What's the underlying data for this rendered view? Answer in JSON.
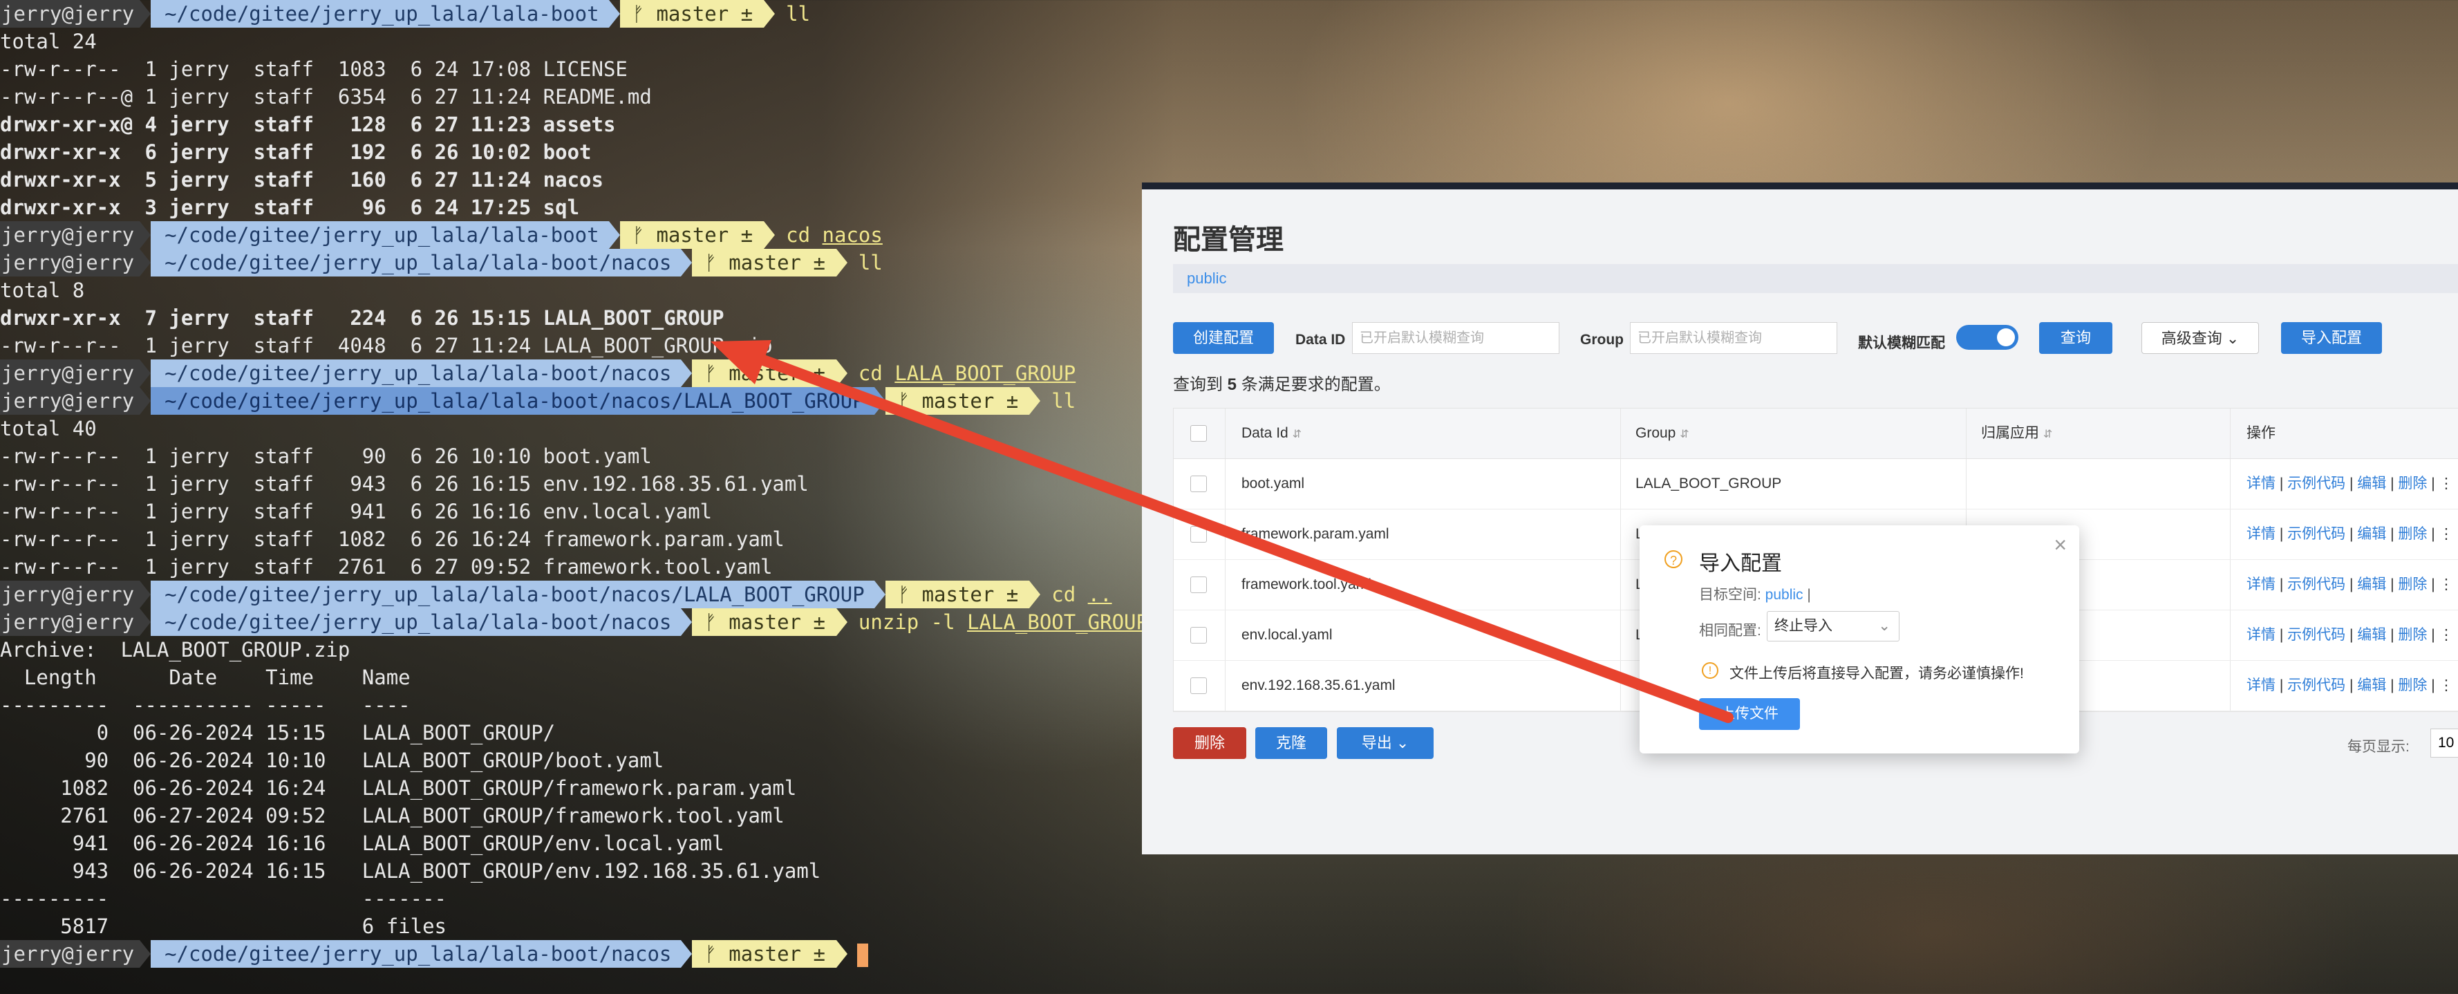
{
  "terminal": {
    "prompt_user": "jerry@jerry",
    "lines": [
      {
        "type": "prompt",
        "path": "~/code/gitee/jerry_up_lala/lala-boot",
        "git": "ᚠ master ±",
        "cmd": "ll"
      },
      {
        "type": "text",
        "text": "total 24"
      },
      {
        "type": "text",
        "text": "-rw-r--r--  1 jerry  staff  1083  6 24 17:08 LICENSE"
      },
      {
        "type": "text",
        "text": "-rw-r--r--@ 1 jerry  staff  6354  6 27 11:24 README.md"
      },
      {
        "type": "text",
        "text": "drwxr-xr-x@ 4 jerry  staff   128  6 27 11:23 assets",
        "bold": true
      },
      {
        "type": "text",
        "text": "drwxr-xr-x  6 jerry  staff   192  6 26 10:02 boot",
        "bold": true
      },
      {
        "type": "text",
        "text": "drwxr-xr-x  5 jerry  staff   160  6 27 11:24 nacos",
        "bold": true
      },
      {
        "type": "text",
        "text": "drwxr-xr-x  3 jerry  staff    96  6 24 17:25 sql",
        "bold": true
      },
      {
        "type": "prompt",
        "path": "~/code/gitee/jerry_up_lala/lala-boot",
        "git": "ᚠ master ±",
        "cmd": "cd nacos"
      },
      {
        "type": "prompt",
        "path": "~/code/gitee/jerry_up_lala/lala-boot/nacos",
        "git": "ᚠ master ±",
        "cmd": "ll"
      },
      {
        "type": "text",
        "text": "total 8"
      },
      {
        "type": "text",
        "text": "drwxr-xr-x  7 jerry  staff   224  6 26 15:15 LALA_BOOT_GROUP",
        "bold": true
      },
      {
        "type": "text",
        "text": "-rw-r--r--  1 jerry  staff  4048  6 27 11:24 LALA_BOOT_GROUP.zip"
      },
      {
        "type": "prompt",
        "path": "~/code/gitee/jerry_up_lala/lala-boot/nacos",
        "git": "ᚠ master ±",
        "cmd": "cd LALA_BOOT_GROUP"
      },
      {
        "type": "prompt",
        "path": "~/code/gitee/jerry_up_lala/lala-boot/nacos/LALA_BOOT_GROUP",
        "git": "ᚠ master ±",
        "cmd": "ll",
        "active": true
      },
      {
        "type": "text",
        "text": "total 40"
      },
      {
        "type": "text",
        "text": "-rw-r--r--  1 jerry  staff    90  6 26 10:10 boot.yaml"
      },
      {
        "type": "text",
        "text": "-rw-r--r--  1 jerry  staff   943  6 26 16:15 env.192.168.35.61.yaml"
      },
      {
        "type": "text",
        "text": "-rw-r--r--  1 jerry  staff   941  6 26 16:16 env.local.yaml"
      },
      {
        "type": "text",
        "text": "-rw-r--r--  1 jerry  staff  1082  6 26 16:24 framework.param.yaml"
      },
      {
        "type": "text",
        "text": "-rw-r--r--  1 jerry  staff  2761  6 27 09:52 framework.tool.yaml"
      },
      {
        "type": "prompt",
        "path": "~/code/gitee/jerry_up_lala/lala-boot/nacos/LALA_BOOT_GROUP",
        "git": "ᚠ master ±",
        "cmd": "cd .."
      },
      {
        "type": "prompt",
        "path": "~/code/gitee/jerry_up_lala/lala-boot/nacos",
        "git": "ᚠ master ±",
        "cmd": "unzip -l LALA_BOOT_GROUP.zip"
      },
      {
        "type": "text",
        "text": "Archive:  LALA_BOOT_GROUP.zip"
      },
      {
        "type": "text",
        "text": "  Length      Date    Time    Name"
      },
      {
        "type": "text",
        "text": "---------  ---------- -----   ----"
      },
      {
        "type": "text",
        "text": "        0  06-26-2024 15:15   LALA_BOOT_GROUP/"
      },
      {
        "type": "text",
        "text": "       90  06-26-2024 10:10   LALA_BOOT_GROUP/boot.yaml"
      },
      {
        "type": "text",
        "text": "     1082  06-26-2024 16:24   LALA_BOOT_GROUP/framework.param.yaml"
      },
      {
        "type": "text",
        "text": "     2761  06-27-2024 09:52   LALA_BOOT_GROUP/framework.tool.yaml"
      },
      {
        "type": "text",
        "text": "      941  06-26-2024 16:16   LALA_BOOT_GROUP/env.local.yaml"
      },
      {
        "type": "text",
        "text": "      943  06-26-2024 16:15   LALA_BOOT_GROUP/env.192.168.35.61.yaml"
      },
      {
        "type": "text",
        "text": "---------                     -------"
      },
      {
        "type": "text",
        "text": "     5817                     6 files"
      },
      {
        "type": "prompt",
        "path": "~/code/gitee/jerry_up_lala/lala-boot/nacos",
        "git": "ᚠ master ±",
        "cmd": "",
        "cursor": true
      }
    ]
  },
  "nacos": {
    "title": "配置管理",
    "namespace": "public",
    "toolbar": {
      "create_label": "创建配置",
      "dataid_label": "Data ID",
      "dataid_placeholder": "已开启默认模糊查询",
      "group_label": "Group",
      "group_placeholder": "已开启默认模糊查询",
      "fuzzy_label": "默认模糊匹配",
      "fuzzy_on": true,
      "query_label": "查询",
      "advanced_label": "高级查询 ⌄",
      "import_label": "导入配置"
    },
    "summary_prefix": "查询到 ",
    "summary_count": "5",
    "summary_suffix": " 条满足要求的配置。",
    "table": {
      "headers": [
        "Data Id",
        "Group",
        "归属应用",
        "操作"
      ],
      "sort_icon": "⇵",
      "rows": [
        {
          "dataid": "boot.yaml",
          "group": "LALA_BOOT_GROUP",
          "app": ""
        },
        {
          "dataid": "framework.param.yaml",
          "group": "LALA_BOOT_GROUP",
          "app": ""
        },
        {
          "dataid": "framework.tool.yaml",
          "group": "LALA_BOOT_GROUP",
          "app": ""
        },
        {
          "dataid": "env.local.yaml",
          "group": "LALA_BOOT_GROUP",
          "app": ""
        },
        {
          "dataid": "env.192.168.35.61.yaml",
          "group": "LALA_BOOT_GROUP",
          "app": ""
        }
      ],
      "ops": [
        "详情",
        "示例代码",
        "编辑",
        "删除"
      ],
      "more": "⋮"
    },
    "footer": {
      "delete_label": "删除",
      "clone_label": "克隆",
      "export_label": "导出 ⌄",
      "page_size_label": "每页显示:",
      "page_size": "10"
    }
  },
  "dialog": {
    "title": "导入配置",
    "close": "×",
    "q_icon": "?",
    "ns_label": "目标空间: ",
    "ns_value": "public",
    "ns_bar": " |",
    "same_label": "相同配置:",
    "same_value": "终止导入",
    "chev": "⌄",
    "warn_icon": "!",
    "warn_text": "文件上传后将直接导入配置，请务必谨慎操作!",
    "upload_label": "上传文件"
  },
  "colors": {
    "accent": "#2f7ed8",
    "danger": "#c0392b",
    "annotation_arrow": "#e8432e"
  }
}
